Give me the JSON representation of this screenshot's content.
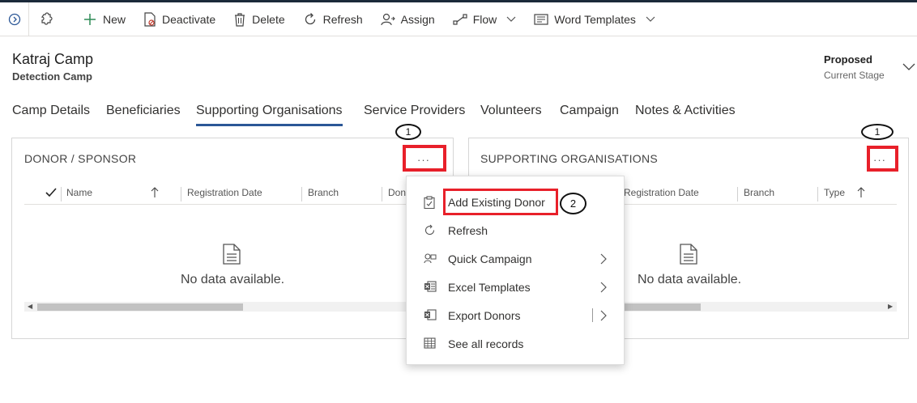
{
  "command_bar": {
    "new": "New",
    "deactivate": "Deactivate",
    "delete": "Delete",
    "refresh": "Refresh",
    "assign": "Assign",
    "flow": "Flow",
    "word_templates": "Word Templates"
  },
  "record": {
    "title": "Katraj Camp",
    "entity": "Detection Camp",
    "stage_value": "Proposed",
    "stage_label": "Current Stage"
  },
  "tabs": [
    "Camp Details",
    "Beneficiaries",
    "Supporting Organisations",
    "Service Providers",
    "Volunteers",
    "Campaign",
    "Notes & Activities"
  ],
  "donor_panel": {
    "title": "DONOR / SPONSOR",
    "more": "···",
    "columns": [
      "Name",
      "Registration Date",
      "Branch",
      "Don"
    ],
    "empty_text": "No data available."
  },
  "orgs_panel": {
    "title": "SUPPORTING ORGANISATIONS",
    "more": "···",
    "columns": [
      "Registration Date",
      "Branch",
      "Type"
    ],
    "empty_text": "No data available."
  },
  "annotations": {
    "marker_1": "1",
    "marker_2": "2"
  },
  "menu": {
    "items": [
      {
        "label": "Add Existing Donor",
        "icon": "clipboard-icon"
      },
      {
        "label": "Refresh",
        "icon": "refresh-icon"
      },
      {
        "label": "Quick Campaign",
        "icon": "quick-campaign-icon"
      },
      {
        "label": "Excel Templates",
        "icon": "excel-icon"
      },
      {
        "label": "Export Donors",
        "icon": "excel-export-icon"
      },
      {
        "label": "See all records",
        "icon": "table-icon"
      }
    ]
  },
  "colors": {
    "accent": "#2b5797",
    "highlight": "#e8202a",
    "new_icon": "#2e8b57"
  }
}
